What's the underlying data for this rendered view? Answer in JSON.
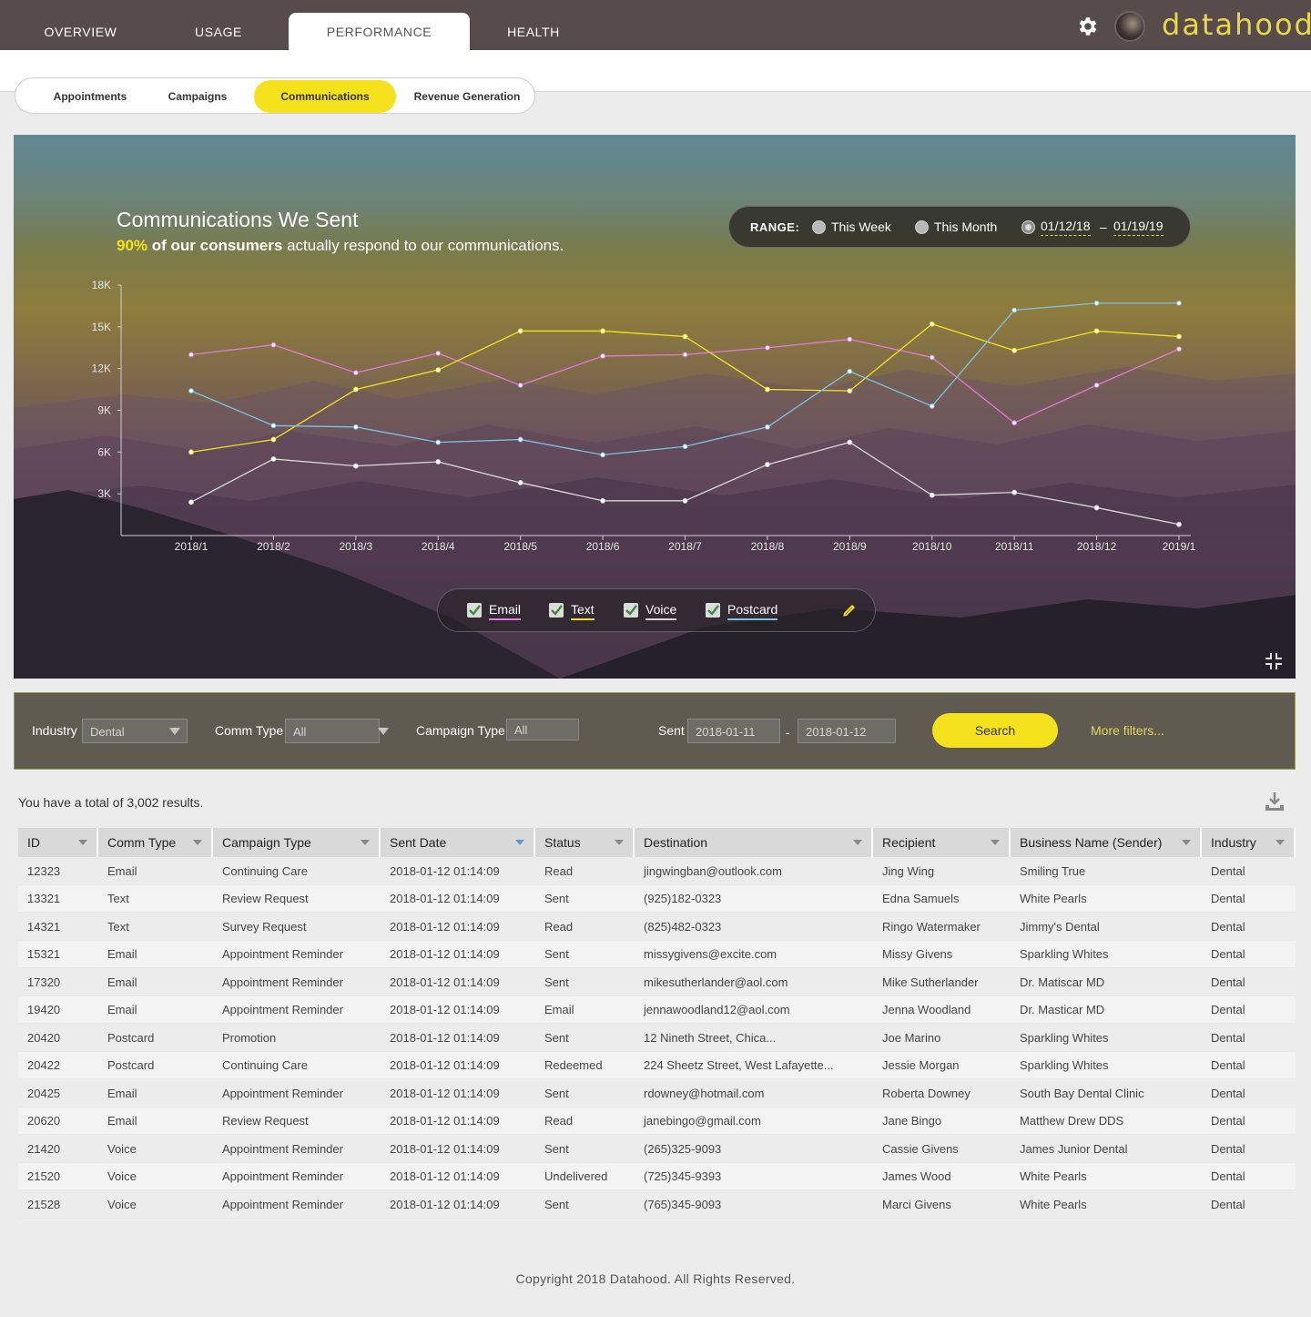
{
  "nav": {
    "tabs": [
      {
        "label": "OVERVIEW"
      },
      {
        "label": "USAGE"
      },
      {
        "label": "PERFORMANCE",
        "active": true
      },
      {
        "label": "HEALTH"
      }
    ],
    "brand": "datahood"
  },
  "subtabs": [
    {
      "label": "Appointments"
    },
    {
      "label": "Campaigns"
    },
    {
      "label": "Communications",
      "active": true
    },
    {
      "label": "Revenue Generation"
    }
  ],
  "hero": {
    "title": "Communications We Sent",
    "subtitle_pct": "90%",
    "subtitle_strong": " of our consumers",
    "subtitle_rest": " actually respond to our communications.",
    "range": {
      "label": "RANGE:",
      "option_week": "This Week",
      "option_month": "This Month",
      "date_from": "01/12/18",
      "date_sep": "–",
      "date_to": "01/19/19"
    },
    "legend": [
      {
        "label": "Email",
        "color": "#e27ad6"
      },
      {
        "label": "Text",
        "color": "#f6e21c"
      },
      {
        "label": "Voice",
        "color": "#d8d8d8"
      },
      {
        "label": "Postcard",
        "color": "#7cc3e0"
      }
    ]
  },
  "chart_data": {
    "type": "line",
    "categories": [
      "2018/1",
      "2018/2",
      "2018/3",
      "2018/4",
      "2018/5",
      "2018/6",
      "2018/7",
      "2018/8",
      "2018/9",
      "2018/10",
      "2018/11",
      "2018/12",
      "2019/1"
    ],
    "y_ticks": [
      "3K",
      "6K",
      "9K",
      "12K",
      "15K",
      "18K"
    ],
    "ylim": [
      0,
      18000
    ],
    "series": [
      {
        "name": "Email",
        "color": "#e27ad6",
        "values": [
          13000,
          13700,
          11700,
          13100,
          10800,
          12900,
          13000,
          13500,
          14100,
          12800,
          8100,
          10800,
          13400
        ]
      },
      {
        "name": "Text",
        "color": "#f6e21c",
        "values": [
          6000,
          6900,
          10500,
          11900,
          14700,
          14700,
          14300,
          10500,
          10400,
          15200,
          13300,
          14700,
          14300
        ]
      },
      {
        "name": "Voice",
        "color": "#d8d8d8",
        "values": [
          2400,
          5500,
          5000,
          5300,
          3800,
          2500,
          2500,
          5100,
          6700,
          2900,
          3100,
          2000,
          800
        ]
      },
      {
        "name": "Postcard",
        "color": "#7cc3e0",
        "values": [
          10400,
          7900,
          7800,
          6700,
          6900,
          5800,
          6400,
          7800,
          11800,
          9300,
          16200,
          16700,
          16700
        ]
      }
    ]
  },
  "filters": {
    "industry_label": "Industry",
    "industry_value": "Dental",
    "comm_type_label": "Comm Type",
    "comm_type_value": "All",
    "campaign_type_label": "Campaign Type",
    "campaign_type_value": "All",
    "sent_label": "Sent",
    "sent_from": "2018-01-11",
    "sent_sep": "-",
    "sent_to": "2018-01-12",
    "search_label": "Search",
    "more_label": "More filters..."
  },
  "results_text": "You have a total of 3,002 results.",
  "table": {
    "columns": [
      "ID",
      "Comm Type",
      "Campaign Type",
      "Sent Date",
      "Status",
      "Destination",
      "Recipient",
      "Business Name (Sender)",
      "Industry"
    ],
    "rows": [
      [
        "12323",
        "Email",
        "Continuing Care",
        "2018-01-12 01:14:09",
        "Read",
        "jingwingban@outlook.com",
        "Jing Wing",
        "Smiling True",
        "Dental"
      ],
      [
        "13321",
        "Text",
        "Review Request",
        "2018-01-12 01:14:09",
        "Sent",
        "(925)182-0323",
        "Edna Samuels",
        "White Pearls",
        "Dental"
      ],
      [
        "14321",
        "Text",
        "Survey Request",
        "2018-01-12 01:14:09",
        "Read",
        "(825)482-0323",
        "Ringo Watermaker",
        "Jimmy's Dental",
        "Dental"
      ],
      [
        "15321",
        "Email",
        "Appointment Reminder",
        "2018-01-12 01:14:09",
        "Sent",
        "missygivens@excite.com",
        "Missy Givens",
        "Sparkling Whites",
        "Dental"
      ],
      [
        "17320",
        "Email",
        "Appointment Reminder",
        "2018-01-12 01:14:09",
        "Sent",
        "mikesutherlander@aol.com",
        "Mike Sutherlander",
        "Dr. Matiscar MD",
        "Dental"
      ],
      [
        "19420",
        "Email",
        "Appointment Reminder",
        "2018-01-12 01:14:09",
        "Email",
        "jennawoodland12@aol.com",
        "Jenna Woodland",
        "Dr. Masticar MD",
        "Dental"
      ],
      [
        "20420",
        "Postcard",
        "Promotion",
        "2018-01-12 01:14:09",
        "Sent",
        "12 Nineth Street, Chica...",
        "Joe Marino",
        "Sparkling Whites",
        "Dental"
      ],
      [
        "20422",
        "Postcard",
        "Continuing Care",
        "2018-01-12 01:14:09",
        "Redeemed",
        "224 Sheetz Street, West Lafayette...",
        "Jessie Morgan",
        "Sparkling Whites",
        "Dental"
      ],
      [
        "20425",
        "Email",
        "Appointment Reminder",
        "2018-01-12 01:14:09",
        "Sent",
        "rdowney@hotmail.com",
        "Roberta Downey",
        "South Bay Dental Clinic",
        "Dental"
      ],
      [
        "20620",
        "Email",
        "Review Request",
        "2018-01-12 01:14:09",
        "Read",
        "janebingo@gmail.com",
        "Jane Bingo",
        "Matthew Drew DDS",
        "Dental"
      ],
      [
        "21420",
        "Voice",
        "Appointment Reminder",
        "2018-01-12 01:14:09",
        "Sent",
        "(265)325-9093",
        "Cassie Givens",
        "James Junior Dental",
        "Dental"
      ],
      [
        "21520",
        "Voice",
        "Appointment Reminder",
        "2018-01-12 01:14:09",
        "Undelivered",
        "(725)345-9393",
        "James Wood",
        "White Pearls",
        "Dental"
      ],
      [
        "21528",
        "Voice",
        "Appointment Reminder",
        "2018-01-12 01:14:09",
        "Sent",
        "(765)345-9093",
        "Marci Givens",
        "White Pearls",
        "Dental"
      ]
    ]
  },
  "footer": "Copyright 2018 Datahood. All Rights Reserved."
}
